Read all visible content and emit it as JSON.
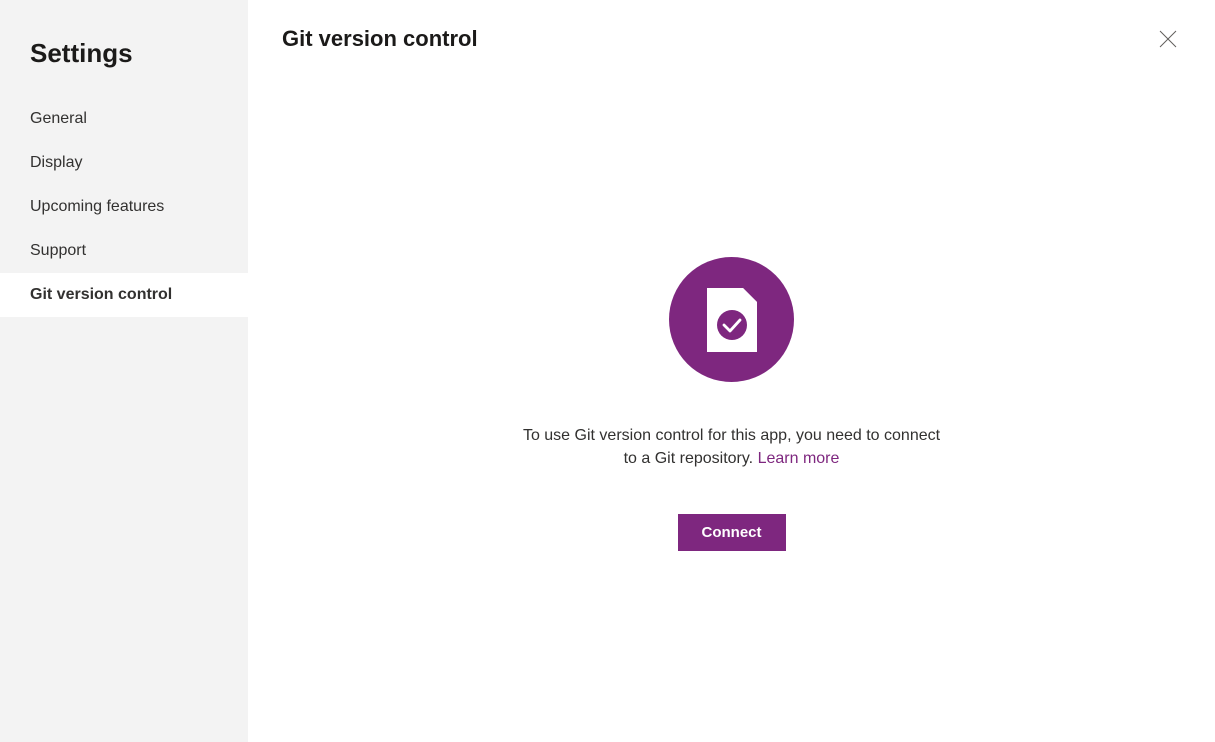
{
  "sidebar": {
    "title": "Settings",
    "items": [
      {
        "label": "General"
      },
      {
        "label": "Display"
      },
      {
        "label": "Upcoming features"
      },
      {
        "label": "Support"
      },
      {
        "label": "Git version control"
      }
    ]
  },
  "main": {
    "title": "Git version control",
    "description": "To use Git version control for this app, you need to connect to a Git repository. ",
    "learn_more": "Learn more",
    "connect_label": "Connect"
  }
}
